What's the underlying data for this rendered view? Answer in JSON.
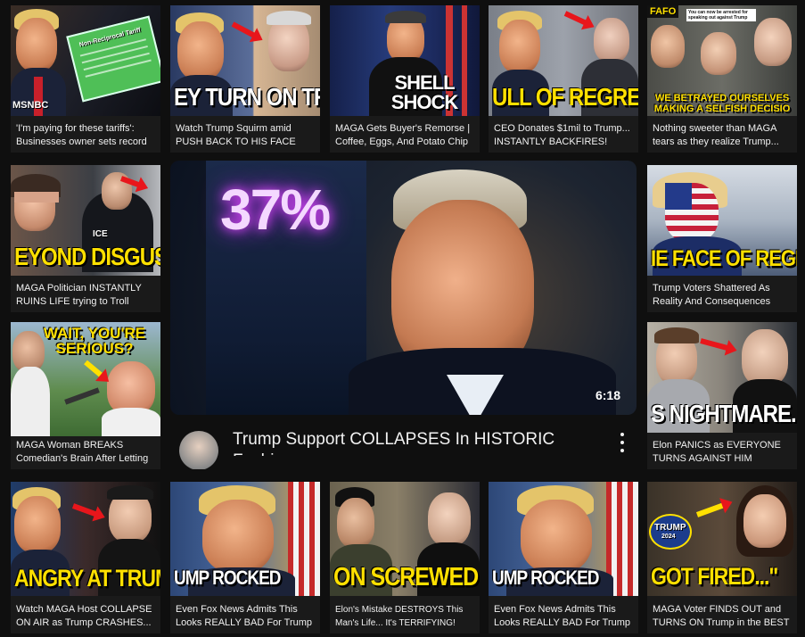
{
  "colors": {
    "background": "#0f0f0f",
    "caption_yellow": "#ffe000",
    "arrow_red": "#e8161b"
  },
  "featured": {
    "overlay_text": "37%",
    "duration": "6:18",
    "title": "Trump Support COLLAPSES In HISTORIC Fashion"
  },
  "videos": [
    {
      "caption": "",
      "overlay": "MSNBC",
      "overlay2": "Non-Reciprocal Tariff",
      "title": "'I'm paying for these tariffs': Businesses owner sets record straight"
    },
    {
      "caption": "EY TURN ON TRUM",
      "overlay": "",
      "overlay2": "",
      "title": "Watch Trump Squirm amid PUSH BACK TO HIS FACE"
    },
    {
      "caption": "SHELL SHOCK",
      "overlay": "",
      "overlay2": "",
      "title": "MAGA Gets Buyer's Remorse | Coffee, Eggs, And Potato Chip Prices Spike |..."
    },
    {
      "caption": "ULL OF REGRET",
      "overlay": "",
      "overlay2": "",
      "title": "CEO Donates $1mil to Trump... INSTANTLY BACKFIRES!"
    },
    {
      "caption": "WE BETRAYED OURSELVES MAKING A SELFISH DECISIO",
      "overlay": "FAFO",
      "overlay2": "You can now be arrested for speaking out against Trump",
      "title": "Nothing sweeter than MAGA tears as they realize Trump..."
    },
    {
      "caption": "EYOND DISGUSTIN",
      "overlay": "ICE",
      "overlay2": "",
      "title": "MAGA Politician INSTANTLY RUINS LIFE trying to Troll Liberal"
    },
    {
      "caption": "IE FACE OF REGRET",
      "overlay": "",
      "overlay2": "",
      "title": "Trump Voters Shattered As Reality And Consequences Settl..."
    },
    {
      "caption": "WAIT, YOU'RE SERIOUS?",
      "overlay": "",
      "overlay2": "",
      "title": "MAGA Woman BREAKS Comedian's Brain After Letting THIS Slip"
    },
    {
      "caption": "S NIGHTMARE.",
      "overlay": "",
      "overlay2": "",
      "title": "Elon PANICS as EVERYONE TURNS AGAINST HIM"
    },
    {
      "caption": "ANGRY AT TRUMP!",
      "overlay": "",
      "overlay2": "",
      "title": "Watch MAGA Host COLLAPSE ON AIR as Trump CRASHES..."
    },
    {
      "caption": "UMP ROCKED",
      "overlay": "",
      "overlay2": "",
      "title": "Even Fox News Admits This Looks REALLY BAD For Trump"
    },
    {
      "caption": "ON SCREWED UP",
      "overlay": "",
      "overlay2": "",
      "title": "Elon's Mistake DESTROYS This Man's Life... It's TERRIFYING!"
    },
    {
      "caption": "UMP ROCKED",
      "overlay": "",
      "overlay2": "",
      "title": "Even Fox News Admits This Looks REALLY BAD For Trump"
    },
    {
      "caption": "GOT FIRED...\"",
      "overlay": "TRUMP",
      "overlay2": "2024",
      "title": "MAGA Voter FINDS OUT and TURNS ON Trump in the BEST Way!"
    }
  ]
}
